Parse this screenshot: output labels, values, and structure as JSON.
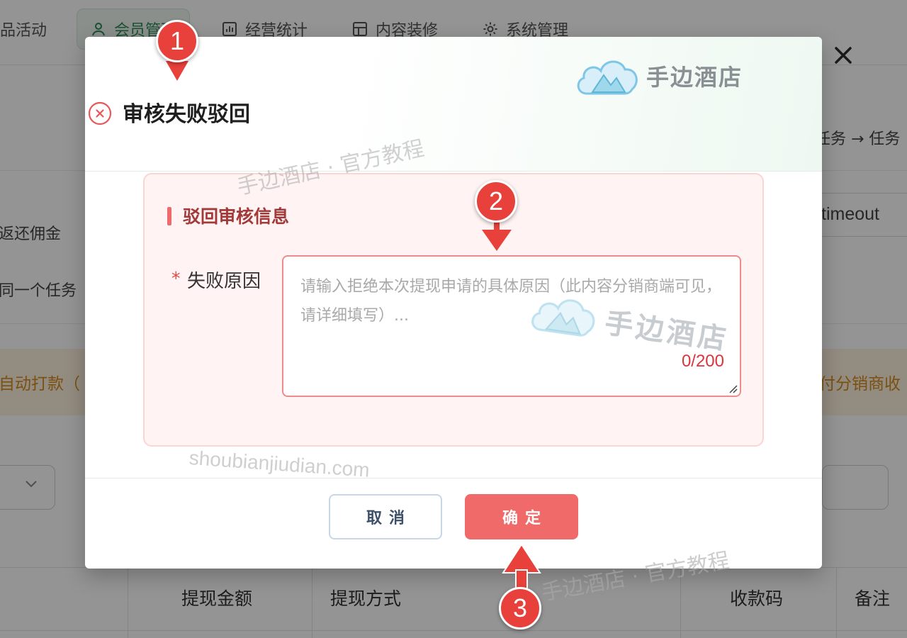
{
  "background": {
    "nav_items": [
      {
        "label": "商品活动",
        "icon": "none"
      },
      {
        "label": "会员管理",
        "icon": "user-icon"
      },
      {
        "label": "经营统计",
        "icon": "bar-chart-icon"
      },
      {
        "label": "内容装修",
        "icon": "layout-icon"
      },
      {
        "label": "系统管理",
        "icon": "gear-icon"
      }
    ],
    "breadcrumb_fragment": "任务 → 任务",
    "row_text_1": "返还佣金",
    "row_text_2": "同一个任务",
    "timeout_text": "timeout",
    "notice_left": "自动打款（",
    "notice_right": "付分销商收",
    "table_headers": [
      "提现金额",
      "提现方式",
      "收款码",
      "备注"
    ]
  },
  "modal": {
    "brand": "手边酒店",
    "title": "审核失败驳回",
    "title_icon": "close-circle-icon",
    "section_title": "驳回审核信息",
    "field_required_mark": "*",
    "field_label": "失败原因",
    "reason_value": "",
    "reason_placeholder": "请输入拒绝本次提现申请的具体原因（此内容分销商端可见，请详细填写）...",
    "char_count": "0/200",
    "cancel_label": "取消",
    "confirm_label": "确定",
    "accent_color": "#f06a6a"
  },
  "watermarks": {
    "line_1": "手边酒店 · 官方教程",
    "line_2": "shoubianjiudian.com",
    "line_3": "手边酒店 · 官方教程",
    "logo_text": "手边酒店"
  },
  "markers": [
    "1",
    "2",
    "3"
  ]
}
